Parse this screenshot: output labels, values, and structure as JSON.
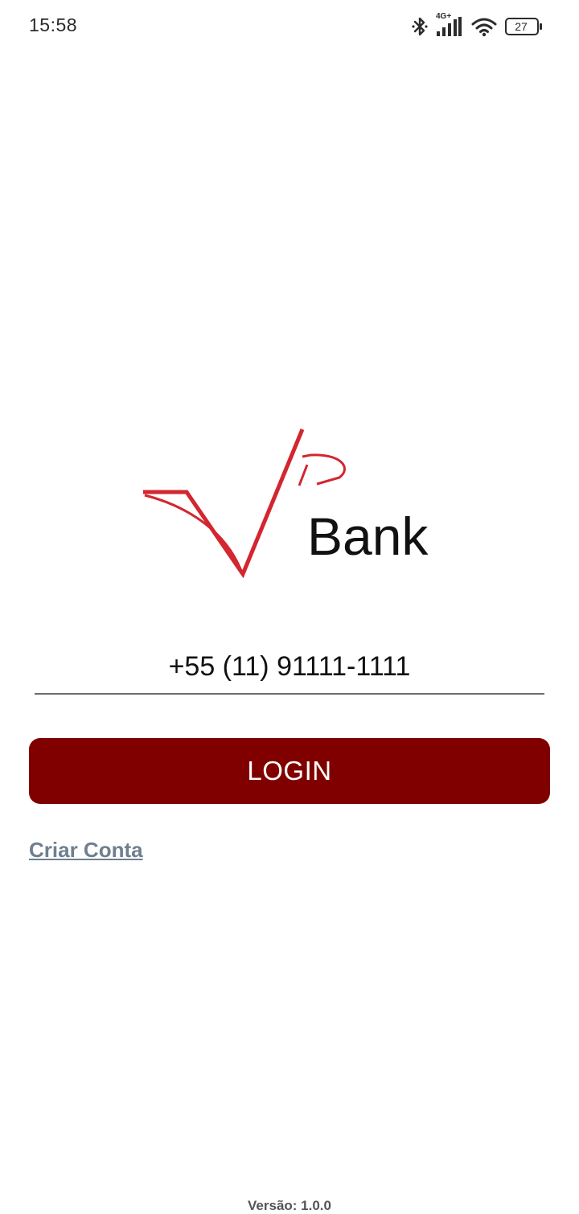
{
  "status_bar": {
    "time": "15:58",
    "network_label": "4G+",
    "battery_level": "27",
    "icons": [
      "bluetooth-icon",
      "signal-icon",
      "wifi-icon",
      "battery-icon"
    ]
  },
  "logo": {
    "text": "Bank",
    "brand_color": "#D32630"
  },
  "login_form": {
    "phone_value": "+55 (11) 91111-1111",
    "login_label": "LOGIN",
    "login_button_color": "#800000"
  },
  "create_account": {
    "label": "Criar Conta"
  },
  "footer": {
    "version": "Versão: 1.0.0"
  }
}
